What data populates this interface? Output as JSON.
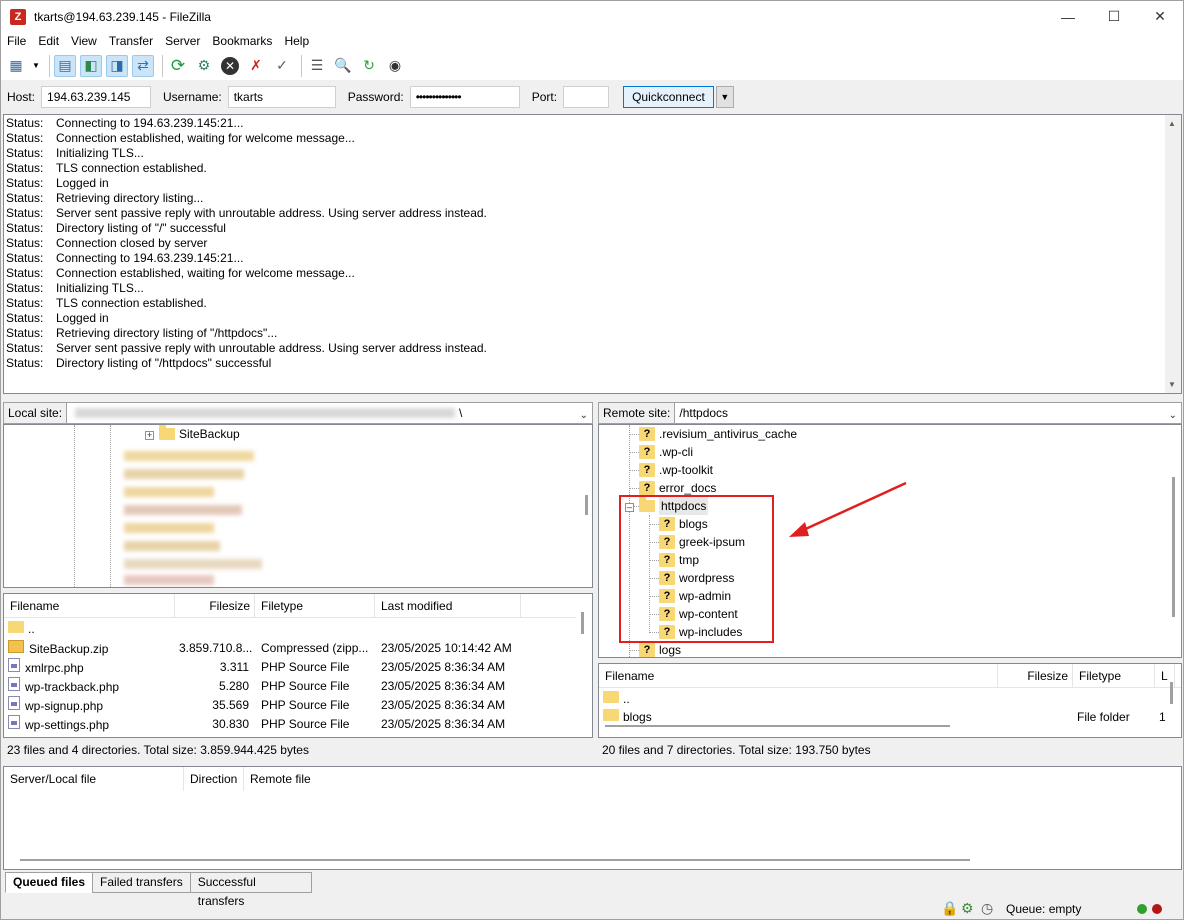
{
  "window": {
    "title": "tkarts@194.63.239.145 - FileZilla",
    "icon": "filezilla-icon"
  },
  "menu": [
    "File",
    "Edit",
    "View",
    "Transfer",
    "Server",
    "Bookmarks",
    "Help"
  ],
  "quickconnect": {
    "host_label": "Host:",
    "host": "194.63.239.145",
    "username_label": "Username:",
    "username": "tkarts",
    "password_label": "Password:",
    "password": "••••••••••••••",
    "port_label": "Port:",
    "port": "",
    "button": "Quickconnect"
  },
  "log": [
    {
      "k": "Status:",
      "v": "Connecting to 194.63.239.145:21..."
    },
    {
      "k": "Status:",
      "v": "Connection established, waiting for welcome message..."
    },
    {
      "k": "Status:",
      "v": "Initializing TLS..."
    },
    {
      "k": "Status:",
      "v": "TLS connection established."
    },
    {
      "k": "Status:",
      "v": "Logged in"
    },
    {
      "k": "Status:",
      "v": "Retrieving directory listing..."
    },
    {
      "k": "Status:",
      "v": "Server sent passive reply with unroutable address. Using server address instead."
    },
    {
      "k": "Status:",
      "v": "Directory listing of \"/\" successful"
    },
    {
      "k": "Status:",
      "v": "Connection closed by server"
    },
    {
      "k": "Status:",
      "v": "Connecting to 194.63.239.145:21..."
    },
    {
      "k": "Status:",
      "v": "Connection established, waiting for welcome message..."
    },
    {
      "k": "Status:",
      "v": "Initializing TLS..."
    },
    {
      "k": "Status:",
      "v": "TLS connection established."
    },
    {
      "k": "Status:",
      "v": "Logged in"
    },
    {
      "k": "Status:",
      "v": "Retrieving directory listing of \"/httpdocs\"..."
    },
    {
      "k": "Status:",
      "v": "Server sent passive reply with unroutable address. Using server address instead."
    },
    {
      "k": "Status:",
      "v": "Directory listing of \"/httpdocs\" successful"
    }
  ],
  "local": {
    "site_label": "Local site:",
    "site_path_suffix": "\\",
    "tree_visible": "SiteBackup",
    "columns": [
      "Filename",
      "Filesize",
      "Filetype",
      "Last modified"
    ],
    "files": [
      {
        "name": "..",
        "size": "",
        "type": "",
        "modified": "",
        "icon": "folder"
      },
      {
        "name": "SiteBackup.zip",
        "size": "3.859.710.8...",
        "type": "Compressed (zipp...",
        "modified": "23/05/2025 10:14:42 AM",
        "icon": "zip"
      },
      {
        "name": "xmlrpc.php",
        "size": "3.311",
        "type": "PHP Source File",
        "modified": "23/05/2025 8:36:34 AM",
        "icon": "php"
      },
      {
        "name": "wp-trackback.php",
        "size": "5.280",
        "type": "PHP Source File",
        "modified": "23/05/2025 8:36:34 AM",
        "icon": "php"
      },
      {
        "name": "wp-signup.php",
        "size": "35.569",
        "type": "PHP Source File",
        "modified": "23/05/2025 8:36:34 AM",
        "icon": "php"
      },
      {
        "name": "wp-settings.php",
        "size": "30.830",
        "type": "PHP Source File",
        "modified": "23/05/2025 8:36:34 AM",
        "icon": "php"
      }
    ],
    "status": "23 files and 4 directories. Total size: 3.859.944.425 bytes"
  },
  "remote": {
    "site_label": "Remote site:",
    "site_path": "/httpdocs",
    "tree": [
      {
        "name": ".revisium_antivirus_cache",
        "depth": 1
      },
      {
        "name": ".wp-cli",
        "depth": 1
      },
      {
        "name": ".wp-toolkit",
        "depth": 1
      },
      {
        "name": "error_docs",
        "depth": 1
      },
      {
        "name": "httpdocs",
        "depth": 1,
        "expanded": true
      },
      {
        "name": "blogs",
        "depth": 2
      },
      {
        "name": "greek-ipsum",
        "depth": 2
      },
      {
        "name": "tmp",
        "depth": 2
      },
      {
        "name": "wordpress",
        "depth": 2
      },
      {
        "name": "wp-admin",
        "depth": 2
      },
      {
        "name": "wp-content",
        "depth": 2
      },
      {
        "name": "wp-includes",
        "depth": 2
      },
      {
        "name": "logs",
        "depth": 1
      }
    ],
    "columns": [
      "Filename",
      "Filesize",
      "Filetype",
      "L"
    ],
    "files": [
      {
        "name": "..",
        "size": "",
        "type": ""
      },
      {
        "name": "blogs",
        "size": "",
        "type": "File folder",
        "extra": "1"
      }
    ],
    "status": "20 files and 7 directories. Total size: 193.750 bytes"
  },
  "queue": {
    "columns": [
      "Server/Local file",
      "Direction",
      "Remote file"
    ],
    "tabs": [
      "Queued files",
      "Failed transfers",
      "Successful transfers"
    ],
    "status": "Queue: empty"
  },
  "colors": {
    "highlight": "#e02020",
    "folder": "#f8d775",
    "accent": "#0078d7"
  }
}
